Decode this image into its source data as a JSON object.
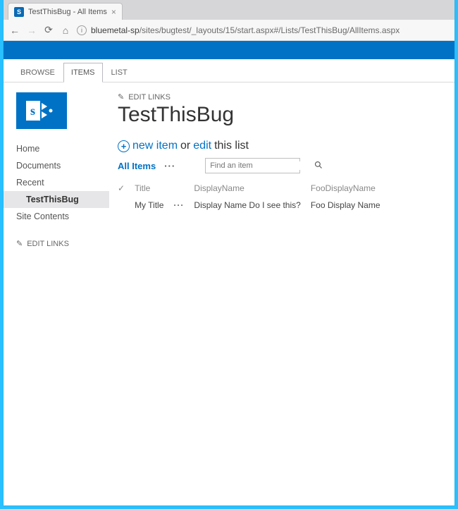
{
  "browser": {
    "tab_title": "TestThisBug - All Items",
    "url_host": "bluemetal-sp",
    "url_path": "/sites/bugtest/_layouts/15/start.aspx#/Lists/TestThisBug/AllItems.aspx"
  },
  "ribbon_tabs": {
    "browse": "BROWSE",
    "items": "ITEMS",
    "list": "LIST"
  },
  "sidebar": {
    "items": [
      {
        "label": "Home"
      },
      {
        "label": "Documents"
      },
      {
        "label": "Recent"
      },
      {
        "label": "TestThisBug"
      },
      {
        "label": "Site Contents"
      }
    ],
    "edit_links": "EDIT LINKS"
  },
  "page": {
    "top_edit_links": "EDIT LINKS",
    "title": "TestThisBug",
    "new_item": "new item",
    "or": "or",
    "edit": "edit",
    "this_list": "this list",
    "all_items": "All Items",
    "search_placeholder": "Find an item"
  },
  "list": {
    "columns": {
      "title": "Title",
      "display_name": "DisplayName",
      "foo_display_name": "FooDisplayName"
    },
    "rows": [
      {
        "title": "My Title",
        "display_name": "Display Name Do I see this?",
        "foo_display_name": "Foo Display Name"
      }
    ]
  }
}
